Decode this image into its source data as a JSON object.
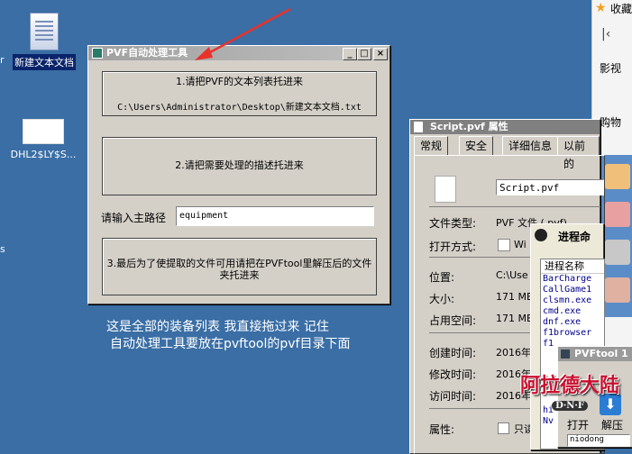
{
  "desktop": {
    "icons": [
      {
        "label": "新建文本文档"
      },
      {
        "label": "DHL2$LY$S..."
      }
    ],
    "edge_labels": [
      "r",
      "s"
    ]
  },
  "browser_side": {
    "top_label": "收藏",
    "back_glyph": "K",
    "nav": [
      "影视",
      "购物"
    ]
  },
  "main_window": {
    "title": "PVF自动处理工具",
    "step1": "1.请把PVF的文本列表托进来",
    "step1_path": "C:\\Users\\Administrator\\Desktop\\新建文本文档.txt",
    "step2": "2.请把需要处理的描述托进来",
    "main_path_label": "请输入主路径",
    "main_path_value": "equipment",
    "step3": "3.最后为了使提取的文件可用请把在PVFtool里解压后的文件夹托进来"
  },
  "annotation": {
    "line1": "这是全部的装备列表 我直接拖过来 记住",
    "line2": "自动处理工具要放在pvftool的pvf目录下面",
    "arrow_color": "#e8322a"
  },
  "properties_window": {
    "title": "Script.pvf 属性",
    "tabs": [
      "常规",
      "安全",
      "详细信息",
      "以前的"
    ],
    "filename": "Script.pvf",
    "rows": [
      {
        "label": "文件类型:",
        "value": "PVF 文件 (.pvf)"
      },
      {
        "label": "打开方式:",
        "value": "Wi"
      },
      {
        "label": "位置:",
        "value": "C:\\Use"
      },
      {
        "label": "大小:",
        "value": "171 MB"
      },
      {
        "label": "占用空间:",
        "value": "171 MB"
      },
      {
        "label": "创建时间:",
        "value": "2016年"
      },
      {
        "label": "修改时间:",
        "value": "2016年"
      },
      {
        "label": "访问时间:",
        "value": "2016年"
      },
      {
        "label": "属性:",
        "value": "只读"
      }
    ]
  },
  "process_window": {
    "title": "进程命",
    "header": "进程名称",
    "items": [
      "BarCharge",
      "CallGame1",
      "clsmn.exe",
      "cmd.exe",
      "dnf.exe",
      "f1browser",
      "f1",
      "hi",
      "Nv"
    ]
  },
  "pvftool_window": {
    "title": "PVFtool 1",
    "buttons": [
      "打开",
      "解压"
    ],
    "field": "niodong"
  },
  "game_logo": {
    "text": "阿拉德大陆",
    "sub": "D·N·F"
  }
}
